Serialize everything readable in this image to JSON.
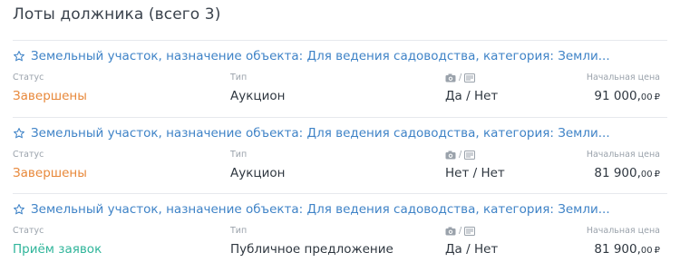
{
  "header": {
    "title": "Лоты должника (всего 3)"
  },
  "labels": {
    "status": "Статус",
    "type": "Тип",
    "media_separator": "/",
    "price": "Начальная цена",
    "currency": "₽"
  },
  "lots": [
    {
      "title": "Земельный участок, назначение объекта: Для ведения садоводства, категория: Земли...",
      "status": "Завершены",
      "status_color": "#e8883a",
      "type": "Аукцион",
      "media": "Да / Нет",
      "price_main": "91 000,",
      "price_cents": "00"
    },
    {
      "title": "Земельный участок, назначение объекта: Для ведения садоводства, категория: Земли...",
      "status": "Завершены",
      "status_color": "#e8883a",
      "type": "Аукцион",
      "media": "Нет / Нет",
      "price_main": "81 900,",
      "price_cents": "00"
    },
    {
      "title": "Земельный участок, назначение объекта: Для ведения садоводства, категория: Земли...",
      "status": "Приём заявок",
      "status_color": "#2fb59a",
      "type": "Публичное предложение",
      "media": "Да / Нет",
      "price_main": "81 900,",
      "price_cents": "00"
    }
  ]
}
